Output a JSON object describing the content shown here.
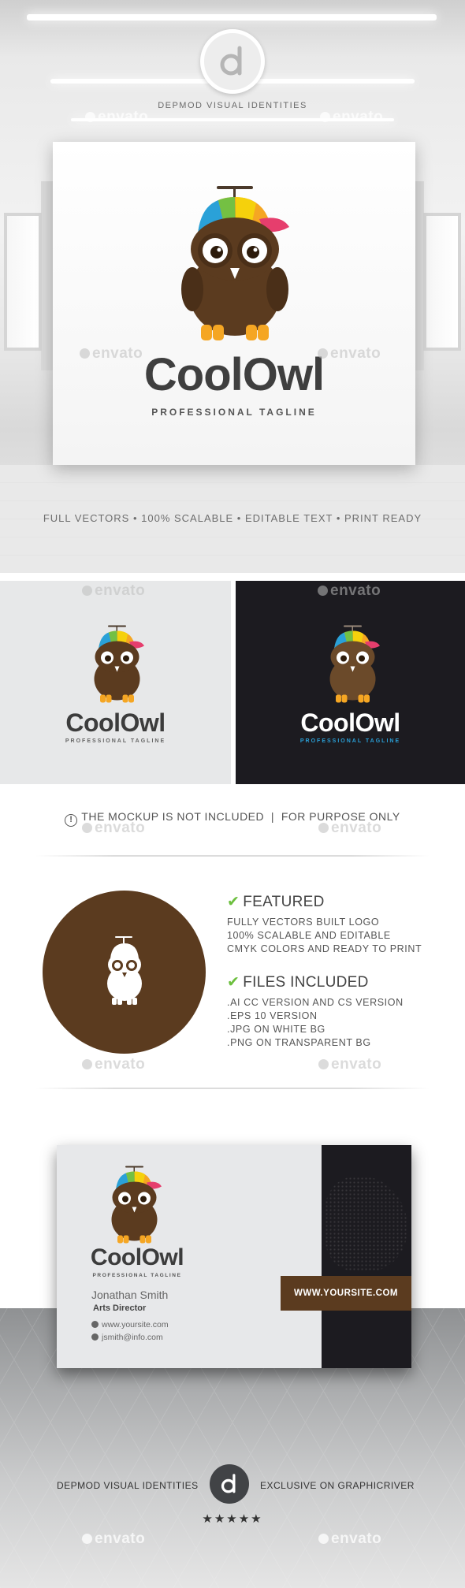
{
  "brand": {
    "name": "DEPMOD VISUAL IDENTITIES",
    "logo_icon": "depmod-d-icon"
  },
  "logo": {
    "name": "CoolOwl",
    "tagline": "PROFESSIONAL TAGLINE"
  },
  "hero": {
    "features_strip": "FULL VECTORS • 100% SCALABLE • EDITABLE TEXT • PRINT READY"
  },
  "watermark": {
    "text": "envato"
  },
  "notice": {
    "text": "THE MOCKUP IS NOT INCLUDED  |  FOR PURPOSE ONLY"
  },
  "featured": {
    "title": "FEATURED",
    "items": [
      "FULLY VECTORS BUILT LOGO",
      "100% SCALABLE AND EDITABLE",
      "CMYK COLORS AND READY TO PRINT"
    ]
  },
  "files": {
    "title": "FILES INCLUDED",
    "items": [
      ".AI CC VERSION AND CS VERSION",
      ".EPS 10 VERSION",
      ".JPG ON WHITE BG",
      ".PNG ON TRANSPARENT BG"
    ]
  },
  "business_card": {
    "person_name": "Jonathan Smith",
    "role": "Arts Director",
    "website": "www.yoursite.com",
    "email": "jsmith@info.com",
    "url_banner": "WWW.YOURSITE.COM"
  },
  "footer": {
    "left": "DEPMOD VISUAL IDENTITIES",
    "right": "EXCLUSIVE ON GRAPHICRIVER",
    "rating": "★★★★★"
  },
  "colors": {
    "owl_brown": "#5b3b1f",
    "owl_feet": "#f5a623",
    "check_green": "#6cbf3e",
    "dark_bg": "#1c1b20",
    "tagline_blue": "#2a9fd6"
  }
}
